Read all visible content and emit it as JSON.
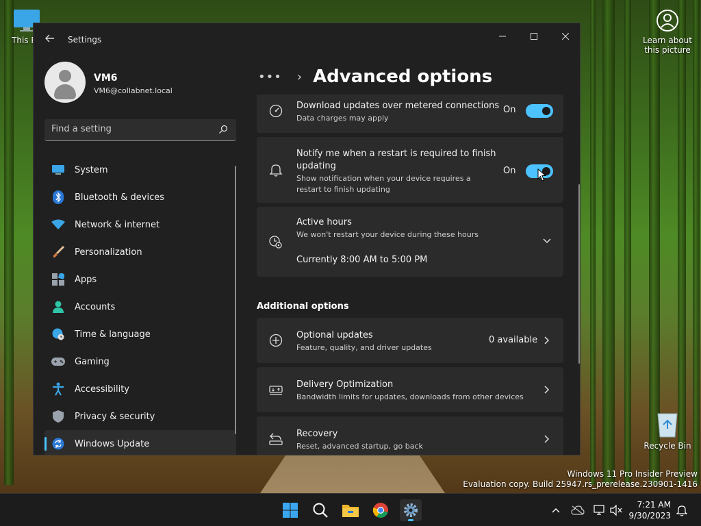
{
  "desktop": {
    "this_pc_label": "This PC",
    "learn_label": "Learn about this picture",
    "recycle_bin_label": "Recycle Bin"
  },
  "window": {
    "title": "Settings"
  },
  "profile": {
    "name": "VM6",
    "email": "VM6@collabnet.local"
  },
  "search": {
    "placeholder": "Find a setting",
    "icon": "search-icon"
  },
  "nav": {
    "items": [
      {
        "label": "System",
        "icon": "monitor-icon"
      },
      {
        "label": "Bluetooth & devices",
        "icon": "bluetooth-icon"
      },
      {
        "label": "Network & internet",
        "icon": "wifi-icon"
      },
      {
        "label": "Personalization",
        "icon": "brush-icon"
      },
      {
        "label": "Apps",
        "icon": "apps-icon"
      },
      {
        "label": "Accounts",
        "icon": "person-icon"
      },
      {
        "label": "Time & language",
        "icon": "globe-clock-icon"
      },
      {
        "label": "Gaming",
        "icon": "gamepad-icon"
      },
      {
        "label": "Accessibility",
        "icon": "accessibility-icon"
      },
      {
        "label": "Privacy & security",
        "icon": "shield-icon"
      },
      {
        "label": "Windows Update",
        "icon": "update-icon",
        "active": true
      }
    ]
  },
  "main": {
    "breadcrumb_overflow": "•••",
    "page_title": "Advanced options",
    "metered": {
      "title": "Download updates over metered connections",
      "subtitle": "Data charges may apply",
      "state": "On"
    },
    "notify": {
      "title_line1": "Notify me when a restart is required to finish",
      "title_line2": "updating",
      "subtitle_line1": "Show notification when your device requires a",
      "subtitle_line2": "restart to finish updating",
      "state": "On"
    },
    "active_hours": {
      "title": "Active hours",
      "subtitle": "We won't restart your device during these hours",
      "current": "Currently 8:00 AM to 5:00 PM"
    },
    "additional_heading": "Additional options",
    "optional_updates": {
      "title": "Optional updates",
      "subtitle": "Feature, quality, and driver updates",
      "value": "0 available"
    },
    "delivery": {
      "title": "Delivery Optimization",
      "subtitle": "Bandwidth limits for updates, downloads from other devices"
    },
    "recovery": {
      "title": "Recovery",
      "subtitle": "Reset, advanced startup, go back"
    }
  },
  "watermark": {
    "line1": "Windows 11 Pro Insider Preview",
    "line2": "Evaluation copy. Build 25947.rs_prerelease.230901-1416"
  },
  "taskbar": {
    "time": "7:21 AM",
    "date": "9/30/2023"
  },
  "colors": {
    "accent": "#4cc2ff",
    "window_bg": "#202020",
    "card_bg": "#2b2b2b"
  }
}
